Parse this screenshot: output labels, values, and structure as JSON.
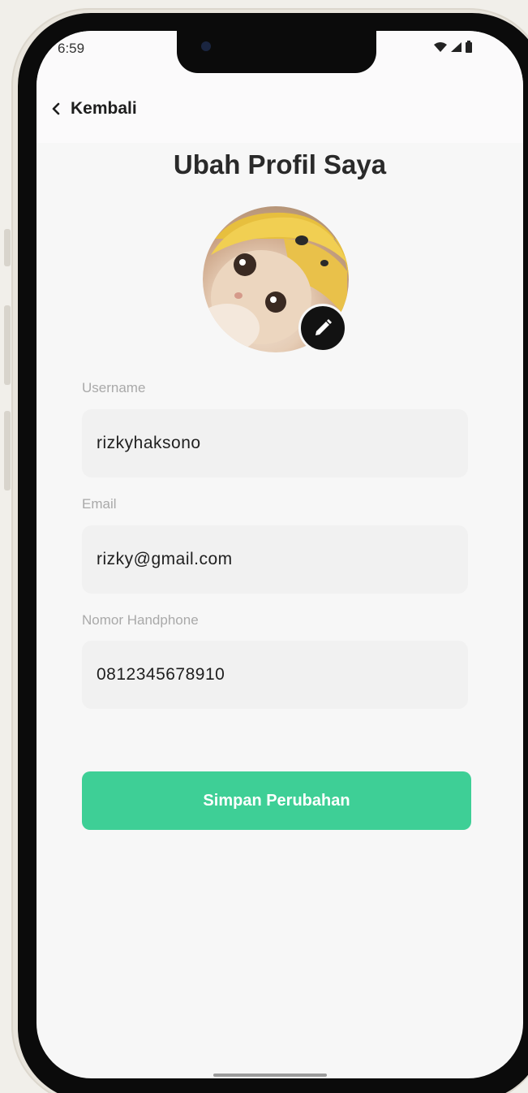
{
  "status_bar": {
    "time": "6:59",
    "icons": [
      "wifi-icon",
      "signal-icon",
      "battery-icon"
    ]
  },
  "nav": {
    "back_label": "Kembali",
    "back_icon": "chevron-left-icon"
  },
  "page": {
    "title": "Ubah Profil Saya"
  },
  "avatar": {
    "description_icon": "profile-photo",
    "edit_icon": "pencil-icon"
  },
  "form": {
    "username": {
      "label": "Username",
      "value": "rizkyhaksono"
    },
    "email": {
      "label": "Email",
      "value": "rizky@gmail.com"
    },
    "phone": {
      "label": "Nomor Handphone",
      "value": "0812345678910"
    }
  },
  "actions": {
    "save_label": "Simpan Perubahan"
  },
  "colors": {
    "accent": "#3ecf96",
    "background": "#f7f7f7",
    "field_bg": "#f1f1f1"
  }
}
